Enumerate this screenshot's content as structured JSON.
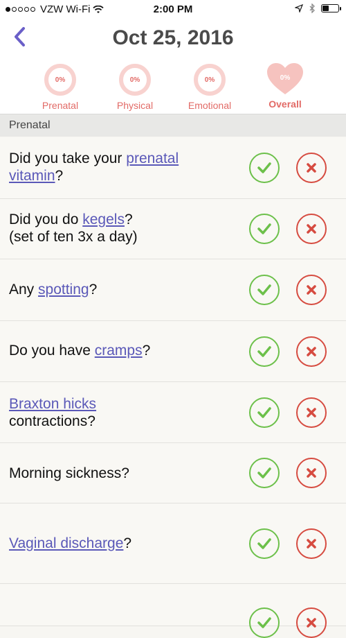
{
  "status": {
    "carrier": "VZW Wi-Fi",
    "time": "2:00 PM",
    "battery_level": 0.4
  },
  "header": {
    "title": "Oct 25, 2016"
  },
  "progress": [
    {
      "label": "Prenatal",
      "value": "0%"
    },
    {
      "label": "Physical",
      "value": "0%"
    },
    {
      "label": "Emotional",
      "value": "0%"
    },
    {
      "label": "Overall",
      "value": "0%"
    }
  ],
  "section": {
    "title": "Prenatal"
  },
  "questions": [
    {
      "pre": "Did you take your ",
      "link": "prenatal vitamin",
      "post": "?",
      "line2": ""
    },
    {
      "pre": "Did you do ",
      "link": "kegels",
      "post": "?",
      "line2": "(set of ten 3x a day)"
    },
    {
      "pre": "Any ",
      "link": "spotting",
      "post": "?",
      "line2": ""
    },
    {
      "pre": "Do you have ",
      "link": "cramps",
      "post": "?",
      "line2": ""
    },
    {
      "pre": "",
      "link": "Braxton hicks",
      "post": "",
      "line2": "contractions?"
    },
    {
      "pre": "Morning sickness?",
      "link": "",
      "post": "",
      "line2": ""
    },
    {
      "pre": "",
      "link": "Vaginal discharge",
      "post": "?",
      "line2": ""
    }
  ],
  "icons": {
    "yes": "check-icon",
    "no": "x-icon",
    "back": "chevron-left-icon"
  },
  "colors": {
    "accent": "#6a5fc8",
    "yes": "#6cc04a",
    "no": "#d64b40",
    "progress": "#e26a66"
  }
}
